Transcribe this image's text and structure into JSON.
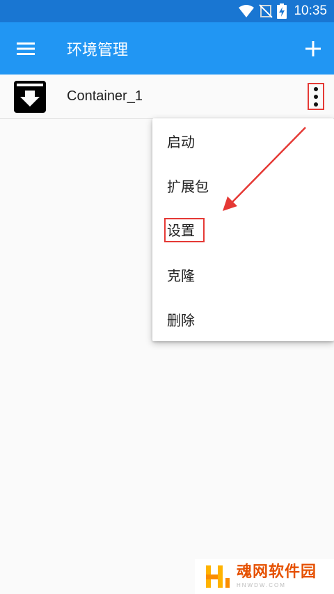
{
  "statusbar": {
    "time": "10:35",
    "icons": [
      "wifi-icon",
      "no-signal-icon",
      "battery-charging-icon"
    ]
  },
  "appbar": {
    "title": "环境管理",
    "menu_icon": "hamburger-menu-icon",
    "add_icon": "plus-icon"
  },
  "containers": [
    {
      "name": "Container_1",
      "icon": "archive-box-icon",
      "more_icon": "more-vert-icon"
    }
  ],
  "popup_menu": {
    "items": [
      {
        "label": "启动"
      },
      {
        "label": "扩展包"
      },
      {
        "label": "设置"
      },
      {
        "label": "克隆"
      },
      {
        "label": "删除"
      }
    ]
  },
  "watermark": {
    "cn": "魂网软件园",
    "en": "HNWDW.COM"
  },
  "colors": {
    "statusbar": "#1976d2",
    "appbar": "#2196f3",
    "annotation": "#e53935",
    "watermark": "#e65100"
  }
}
